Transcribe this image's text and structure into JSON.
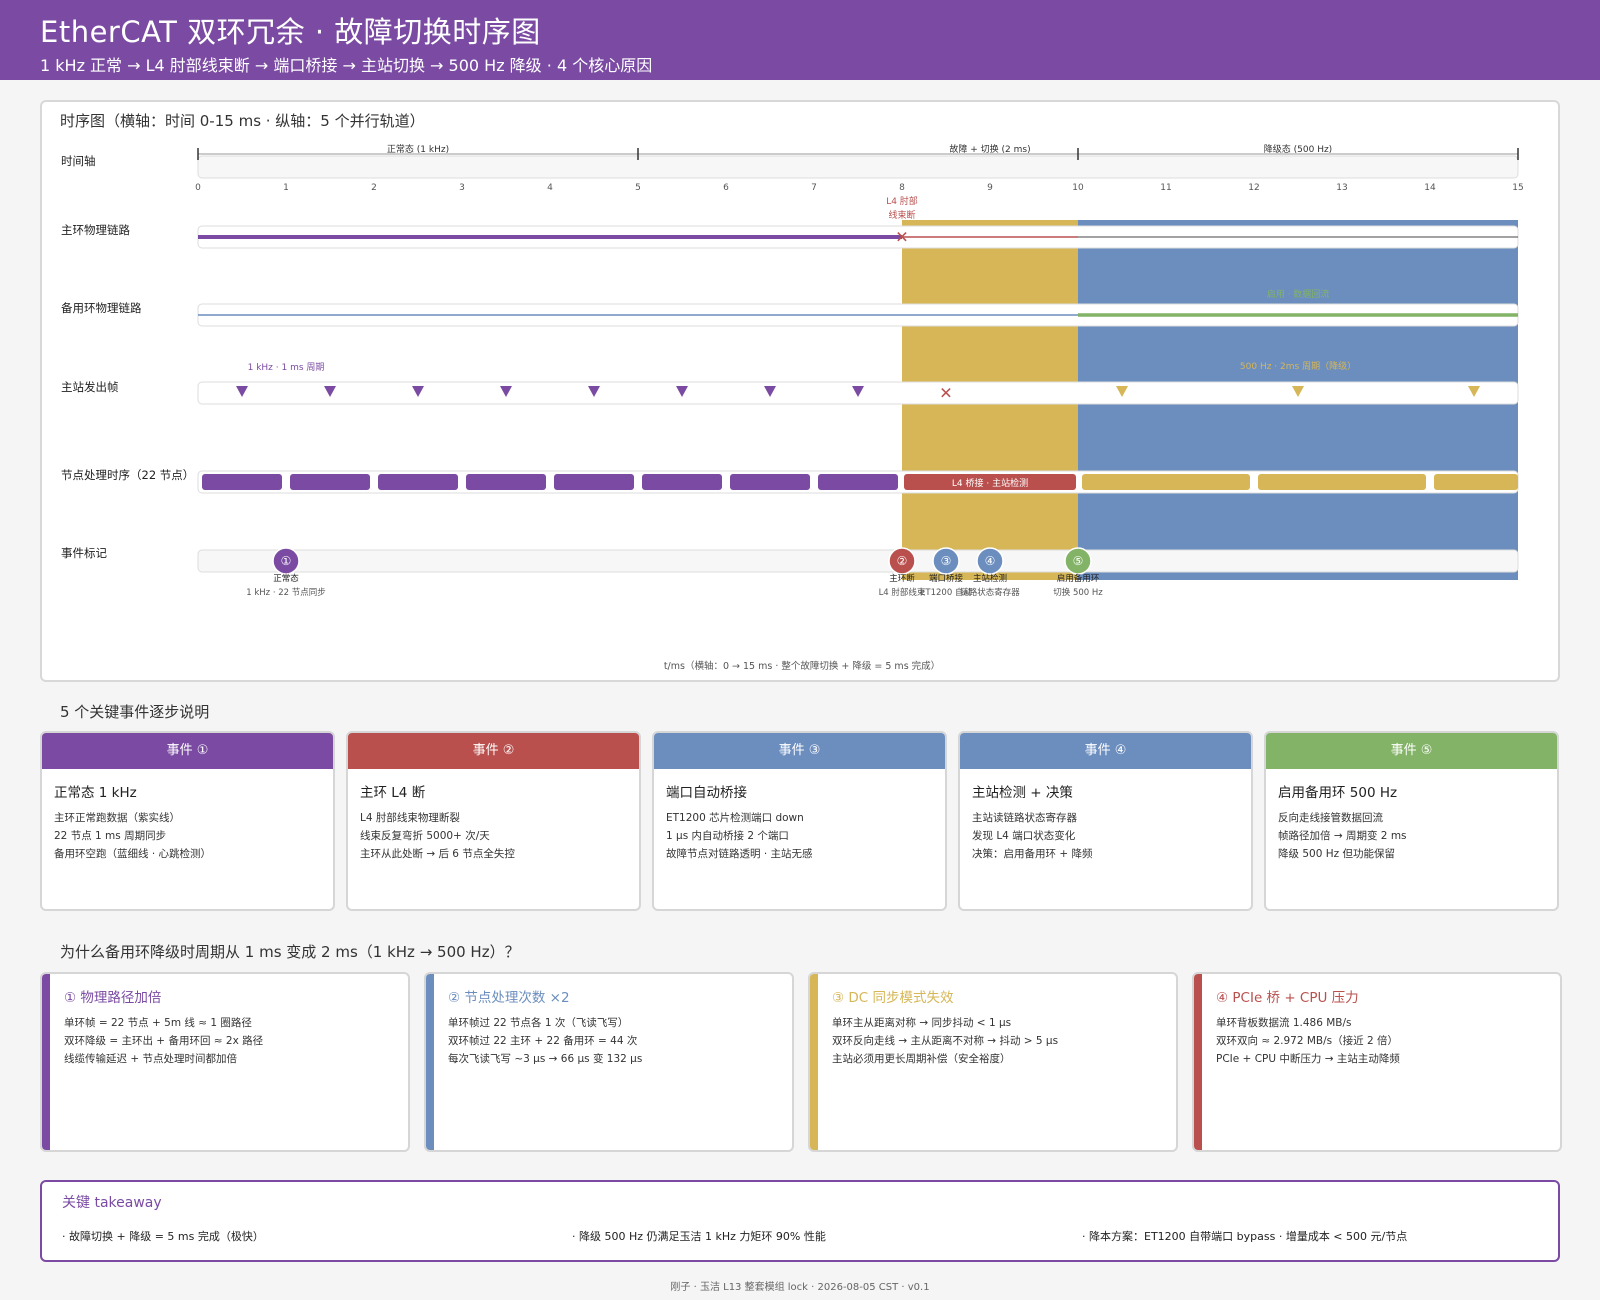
{
  "header": {
    "title": "EtherCAT 双环冗余 ·  故障切换时序图",
    "subtitle": "1 kHz 正常 → L4 肘部线束断 → 端口桥接 → 主站切换 → 500 Hz 降级 ·   4 个核心原因"
  },
  "timing": {
    "title": "时序图（横轴：时间 0-15 ms ·   纵轴：5 个并行轨道）",
    "tracks": [
      "时间轴",
      "主环物理链路",
      "备用环物理链路",
      "主站发出帧",
      "节点处理时序（22 节点）",
      "事件标记"
    ],
    "phases": [
      "正常态 (1 kHz)",
      "故障 + 切换 (2 ms)",
      "降级态 (500 Hz)"
    ],
    "ticks": [
      "0",
      "1",
      "2",
      "3",
      "4",
      "5",
      "6",
      "7",
      "8",
      "9",
      "10",
      "11",
      "12",
      "13",
      "14",
      "15"
    ],
    "break_label_1": "L4 肘部",
    "break_label_2": "线束断",
    "backup_enabled_label": "启用 ·  数据回流",
    "frame_label_normal": "1 kHz ·  1 ms 周期",
    "frame_label_degraded": "500 Hz ·  2ms 周期（降级）",
    "node_fault_label": "L4 桥接 ·  主站检测",
    "markers": [
      {
        "num": "①",
        "title": "正常态",
        "desc": "1 kHz ·  22 节点同步"
      },
      {
        "num": "②",
        "title": "主环断",
        "desc": "L4 肘部线束"
      },
      {
        "num": "③",
        "title": "端口桥接",
        "desc": "ET1200 自动"
      },
      {
        "num": "④",
        "title": "主站检测",
        "desc": "链路状态寄存器"
      },
      {
        "num": "⑤",
        "title": "启用备用环",
        "desc": "切换 500 Hz"
      }
    ],
    "axis_caption": "t/ms（横轴：0 → 15 ms ·   整个故障切换 + 降级 = 5 ms 完成）",
    "colors": {
      "purple": "#7b4ba3",
      "red": "#b9504e",
      "blue": "#6c8ebf",
      "gold": "#d6b656",
      "green": "#82b366"
    }
  },
  "events_section_title": "5 个关键事件逐步说明",
  "events": [
    {
      "head": "事件 ①",
      "title": "正常态 1 kHz",
      "lines": [
        "主环正常跑数据（紫实线）",
        "22 节点 1 ms 周期同步",
        "备用环空跑（蓝细线 ·  心跳检测）"
      ]
    },
    {
      "head": "事件 ②",
      "title": "主环 L4 断",
      "lines": [
        "L4 肘部线束物理断裂",
        "线束反复弯折 5000+ 次/天",
        "主环从此处断 → 后 6 节点全失控"
      ]
    },
    {
      "head": "事件 ③",
      "title": "端口自动桥接",
      "lines": [
        "ET1200 芯片检测端口 down",
        "1 μs 内自动桥接 2 个端口",
        "故障节点对链路透明 ·  主站无感"
      ]
    },
    {
      "head": "事件 ④",
      "title": "主站检测 + 决策",
      "lines": [
        "主站读链路状态寄存器",
        "发现 L4 端口状态变化",
        "决策：启用备用环 + 降频"
      ]
    },
    {
      "head": "事件 ⑤",
      "title": "启用备用环 500 Hz",
      "lines": [
        "反向走线接管数据回流",
        "帧路径加倍 → 周期变 2 ms",
        "降级 500 Hz 但功能保留"
      ]
    }
  ],
  "why_section_title": "为什么备用环降级时周期从 1 ms 变成 2 ms（1 kHz → 500 Hz）？",
  "reasons": [
    {
      "title": "① 物理路径加倍",
      "lines": [
        "单环帧 = 22 节点 + 5m 线 ≈ 1 圈路径",
        "双环降级 = 主环出 + 备用环回 ≈ 2x 路径",
        "线缆传输延迟 + 节点处理时间都加倍"
      ]
    },
    {
      "title": "② 节点处理次数 ×2",
      "lines": [
        "单环帧过 22 节点各 1 次（飞读飞写）",
        "双环帧过 22 主环 + 22 备用环 = 44 次",
        "每次飞读飞写 ~3 μs → 66 μs 变 132 μs"
      ]
    },
    {
      "title": "③ DC 同步模式失效",
      "lines": [
        "单环主从距离对称 → 同步抖动 < 1 μs",
        "双环反向走线 → 主从距离不对称 → 抖动 > 5 μs",
        "主站必须用更长周期补偿（安全裕度）"
      ]
    },
    {
      "title": "④ PCIe 桥 + CPU 压力",
      "lines": [
        "单环背板数据流 1.486 MB/s",
        "双环双向 ≈ 2.972 MB/s（接近 2 倍）",
        "PCIe + CPU 中断压力 → 主站主动降频"
      ]
    }
  ],
  "takeaway": {
    "title": "关键 takeaway",
    "items": [
      "·  故障切换 + 降级 = 5 ms 完成（极快）",
      "·  降级 500 Hz 仍满足玉洁 1 kHz 力矩环 90% 性能",
      "·  降本方案：ET1200 自带端口 bypass ·   增量成本 < 500 元/节点"
    ]
  },
  "footer": "刚子 ·  玉洁 L13 整套模组 lock ·  2026-08-05 CST ·  v0.1"
}
